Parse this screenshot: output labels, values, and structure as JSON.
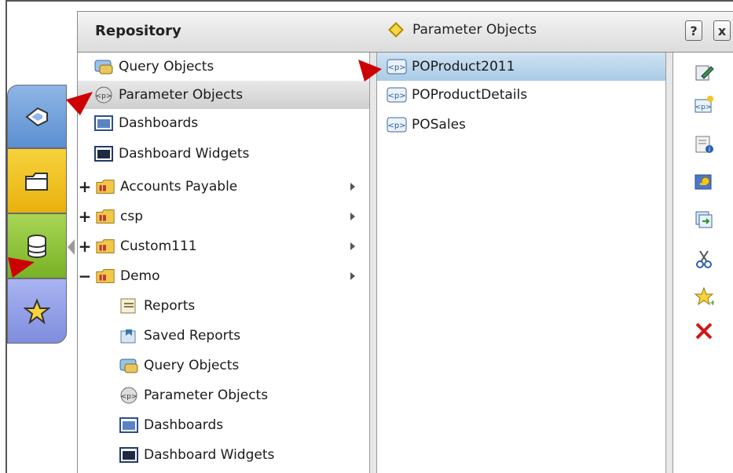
{
  "header": {
    "title": "Repository",
    "breadcrumb": "Parameter Objects",
    "help_label": "?",
    "close_label": "x"
  },
  "tree": {
    "items": [
      {
        "label": "Query Objects",
        "icon": "query-objects-icon"
      },
      {
        "label": "Parameter Objects",
        "icon": "parameter-objects-icon",
        "selected": true
      },
      {
        "label": "Dashboards",
        "icon": "dashboards-icon"
      },
      {
        "label": "Dashboard Widgets",
        "icon": "dashboard-widgets-icon"
      },
      {
        "label": "Accounts Payable",
        "icon": "folder-icon",
        "expander": "+"
      },
      {
        "label": "csp",
        "icon": "folder-icon",
        "expander": "+"
      },
      {
        "label": "Custom111",
        "icon": "folder-icon",
        "expander": "+"
      },
      {
        "label": "Demo",
        "icon": "folder-icon",
        "expander": "−"
      },
      {
        "label": "Reports",
        "icon": "reports-icon"
      },
      {
        "label": "Saved Reports",
        "icon": "saved-reports-icon"
      },
      {
        "label": "Query Objects",
        "icon": "query-objects-icon"
      },
      {
        "label": "Parameter Objects",
        "icon": "parameter-objects-icon"
      },
      {
        "label": "Dashboards",
        "icon": "dashboards-icon"
      },
      {
        "label": "Dashboard Widgets",
        "icon": "dashboard-widgets-icon"
      }
    ]
  },
  "list": {
    "items": [
      {
        "label": "POProduct2011",
        "selected": true
      },
      {
        "label": "POProductDetails"
      },
      {
        "label": "POSales"
      }
    ]
  },
  "colors": {
    "selection_blue": "#b8d5ec",
    "marker_red": "#cc0000"
  }
}
